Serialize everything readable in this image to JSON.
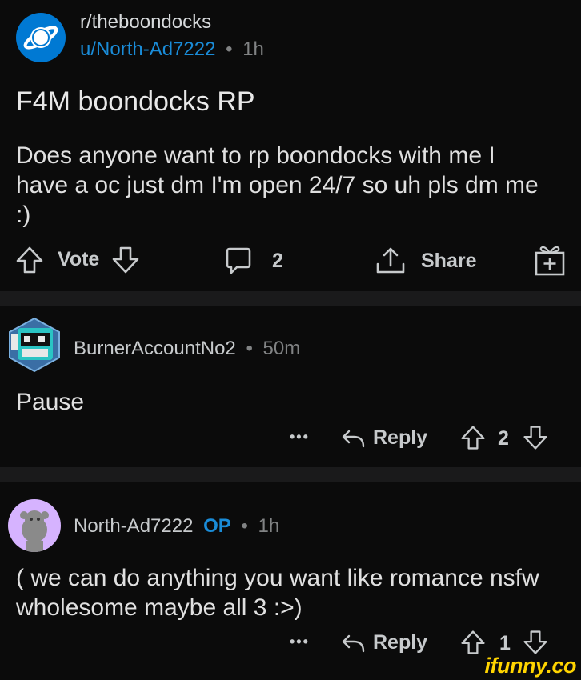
{
  "post": {
    "subreddit": "r/theboondocks",
    "author": "u/North-Ad7222",
    "separator": "•",
    "age": "1h",
    "title": "F4M boondocks RP",
    "body": "Does anyone want to rp boondocks with me I have a oc just dm I'm open 24/7 so uh pls dm me :)",
    "vote_label": "Vote",
    "comment_count": "2",
    "share_label": "Share",
    "icons": [
      "subreddit-planet-icon",
      "upvote-icon",
      "downvote-icon",
      "comment-icon",
      "share-icon",
      "award-gift-icon"
    ]
  },
  "comments": [
    {
      "username": "BurnerAccountNo2",
      "separator": "•",
      "age": "50m",
      "text": "Pause",
      "more": "•••",
      "reply_label": "Reply",
      "score": "2"
    },
    {
      "username": "North-Ad7222",
      "op_badge": "OP",
      "separator": "•",
      "age": "1h",
      "text": "( we can do anything you want like romance nsfw wholesome maybe all 3 :>)",
      "more": "•••",
      "reply_label": "Reply",
      "score": "1"
    }
  ],
  "watermark": "ifunny.co",
  "colors": {
    "background": "#0b0b0b",
    "separator": "#1a1a1b",
    "link_blue": "#1a8cd8",
    "subreddit_icon": "#0079d3",
    "watermark": "#ffd400"
  }
}
